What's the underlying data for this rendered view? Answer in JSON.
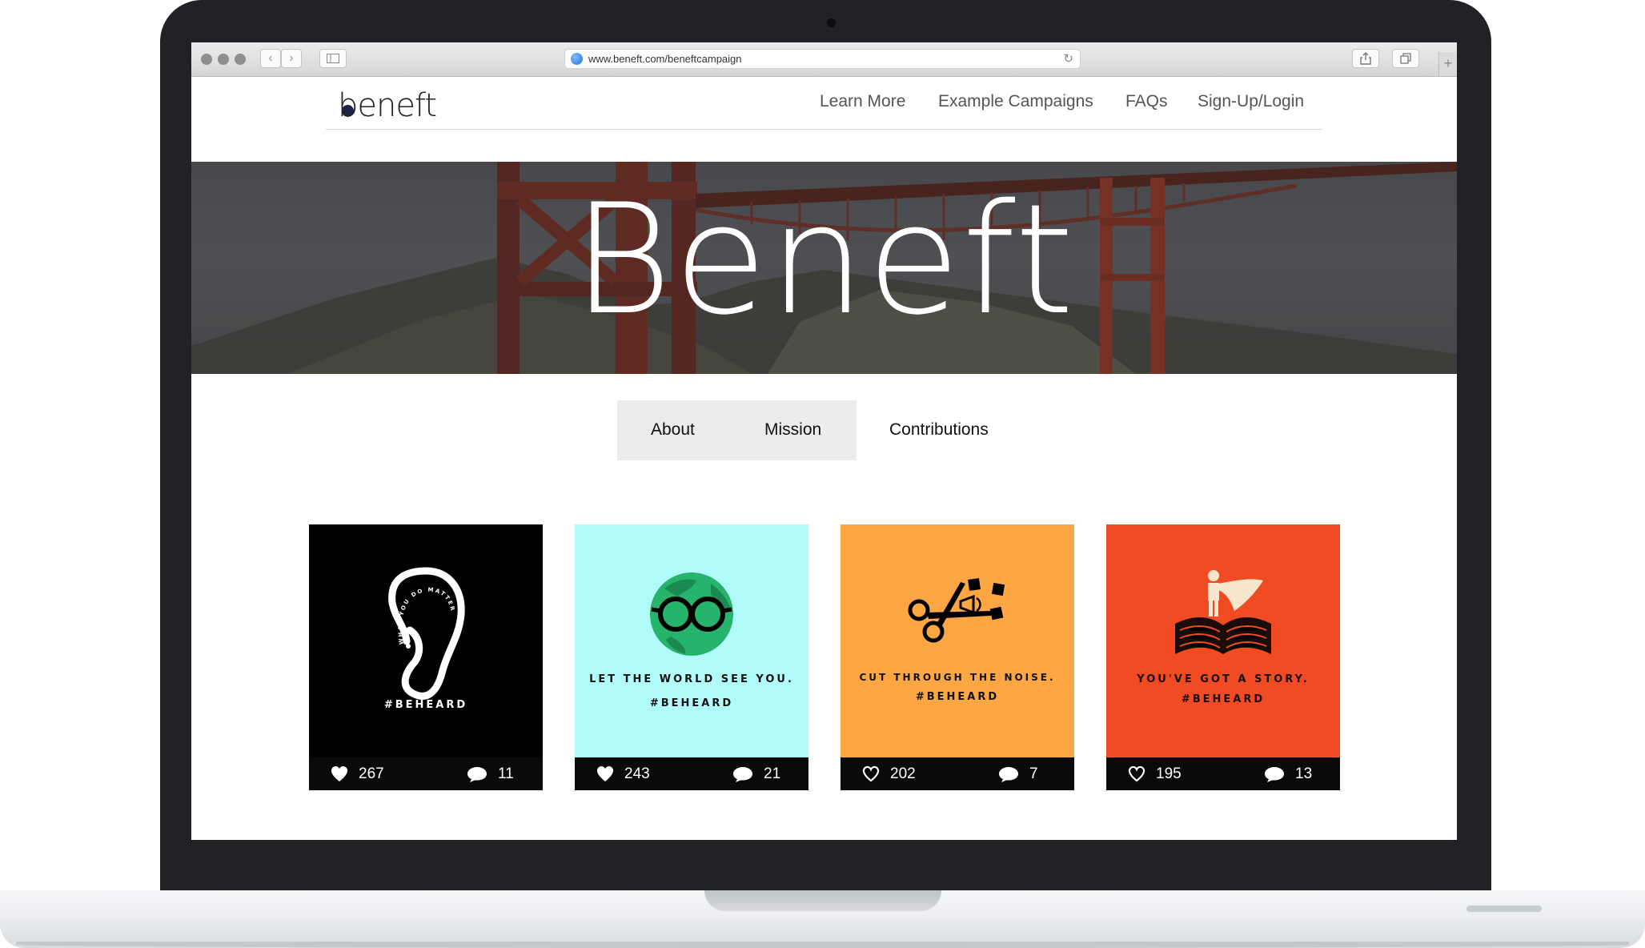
{
  "browser": {
    "url": "www.beneft.com/beneftcampaign"
  },
  "site": {
    "logo": "beneft",
    "nav": [
      "Learn More",
      "Example Campaigns",
      "FAQs",
      "Sign-Up/Login"
    ],
    "hero_title": "Beneft",
    "tabs": [
      "About",
      "Mission",
      "Contributions"
    ]
  },
  "cards": [
    {
      "bg": "#000000",
      "caption": "",
      "tag": "#BEHEARD",
      "curved_text": "WHAT YOU DO MATTERS",
      "likes": "267",
      "comments": "11",
      "icon": "ear-icon"
    },
    {
      "bg": "#b2fbfb",
      "caption": "LET THE WORLD SEE YOU.",
      "tag": "#BEHEARD",
      "likes": "243",
      "comments": "21",
      "icon": "globe-glasses-icon"
    },
    {
      "bg": "#fda644",
      "caption": "CUT THROUGH THE NOISE.",
      "tag": "#BEHEARD",
      "likes": "202",
      "comments": "7",
      "icon": "scissors-icon"
    },
    {
      "bg": "#f04b23",
      "caption": "YOU'VE GOT A STORY.",
      "tag": "#BEHEARD",
      "likes": "195",
      "comments": "13",
      "icon": "book-hero-icon"
    }
  ]
}
